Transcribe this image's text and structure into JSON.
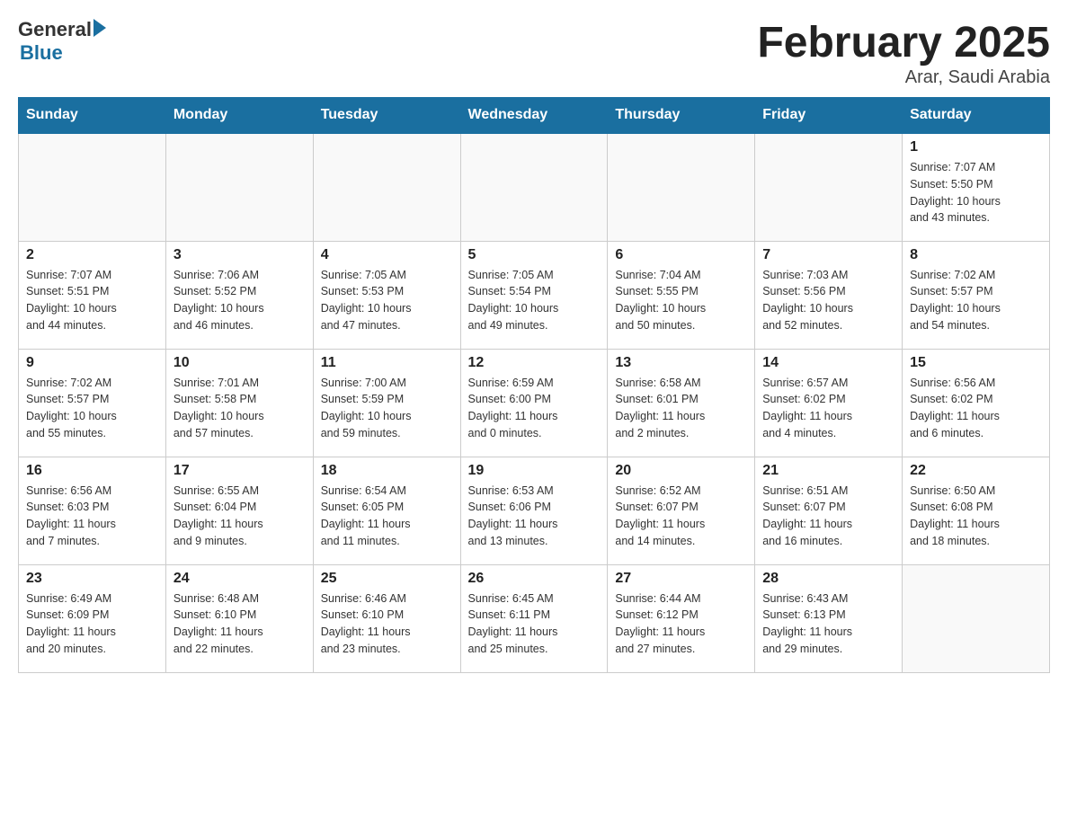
{
  "header": {
    "logo_general": "General",
    "logo_blue": "Blue",
    "month_title": "February 2025",
    "location": "Arar, Saudi Arabia"
  },
  "weekdays": [
    "Sunday",
    "Monday",
    "Tuesday",
    "Wednesday",
    "Thursday",
    "Friday",
    "Saturday"
  ],
  "weeks": [
    [
      {
        "day": "",
        "info": ""
      },
      {
        "day": "",
        "info": ""
      },
      {
        "day": "",
        "info": ""
      },
      {
        "day": "",
        "info": ""
      },
      {
        "day": "",
        "info": ""
      },
      {
        "day": "",
        "info": ""
      },
      {
        "day": "1",
        "info": "Sunrise: 7:07 AM\nSunset: 5:50 PM\nDaylight: 10 hours\nand 43 minutes."
      }
    ],
    [
      {
        "day": "2",
        "info": "Sunrise: 7:07 AM\nSunset: 5:51 PM\nDaylight: 10 hours\nand 44 minutes."
      },
      {
        "day": "3",
        "info": "Sunrise: 7:06 AM\nSunset: 5:52 PM\nDaylight: 10 hours\nand 46 minutes."
      },
      {
        "day": "4",
        "info": "Sunrise: 7:05 AM\nSunset: 5:53 PM\nDaylight: 10 hours\nand 47 minutes."
      },
      {
        "day": "5",
        "info": "Sunrise: 7:05 AM\nSunset: 5:54 PM\nDaylight: 10 hours\nand 49 minutes."
      },
      {
        "day": "6",
        "info": "Sunrise: 7:04 AM\nSunset: 5:55 PM\nDaylight: 10 hours\nand 50 minutes."
      },
      {
        "day": "7",
        "info": "Sunrise: 7:03 AM\nSunset: 5:56 PM\nDaylight: 10 hours\nand 52 minutes."
      },
      {
        "day": "8",
        "info": "Sunrise: 7:02 AM\nSunset: 5:57 PM\nDaylight: 10 hours\nand 54 minutes."
      }
    ],
    [
      {
        "day": "9",
        "info": "Sunrise: 7:02 AM\nSunset: 5:57 PM\nDaylight: 10 hours\nand 55 minutes."
      },
      {
        "day": "10",
        "info": "Sunrise: 7:01 AM\nSunset: 5:58 PM\nDaylight: 10 hours\nand 57 minutes."
      },
      {
        "day": "11",
        "info": "Sunrise: 7:00 AM\nSunset: 5:59 PM\nDaylight: 10 hours\nand 59 minutes."
      },
      {
        "day": "12",
        "info": "Sunrise: 6:59 AM\nSunset: 6:00 PM\nDaylight: 11 hours\nand 0 minutes."
      },
      {
        "day": "13",
        "info": "Sunrise: 6:58 AM\nSunset: 6:01 PM\nDaylight: 11 hours\nand 2 minutes."
      },
      {
        "day": "14",
        "info": "Sunrise: 6:57 AM\nSunset: 6:02 PM\nDaylight: 11 hours\nand 4 minutes."
      },
      {
        "day": "15",
        "info": "Sunrise: 6:56 AM\nSunset: 6:02 PM\nDaylight: 11 hours\nand 6 minutes."
      }
    ],
    [
      {
        "day": "16",
        "info": "Sunrise: 6:56 AM\nSunset: 6:03 PM\nDaylight: 11 hours\nand 7 minutes."
      },
      {
        "day": "17",
        "info": "Sunrise: 6:55 AM\nSunset: 6:04 PM\nDaylight: 11 hours\nand 9 minutes."
      },
      {
        "day": "18",
        "info": "Sunrise: 6:54 AM\nSunset: 6:05 PM\nDaylight: 11 hours\nand 11 minutes."
      },
      {
        "day": "19",
        "info": "Sunrise: 6:53 AM\nSunset: 6:06 PM\nDaylight: 11 hours\nand 13 minutes."
      },
      {
        "day": "20",
        "info": "Sunrise: 6:52 AM\nSunset: 6:07 PM\nDaylight: 11 hours\nand 14 minutes."
      },
      {
        "day": "21",
        "info": "Sunrise: 6:51 AM\nSunset: 6:07 PM\nDaylight: 11 hours\nand 16 minutes."
      },
      {
        "day": "22",
        "info": "Sunrise: 6:50 AM\nSunset: 6:08 PM\nDaylight: 11 hours\nand 18 minutes."
      }
    ],
    [
      {
        "day": "23",
        "info": "Sunrise: 6:49 AM\nSunset: 6:09 PM\nDaylight: 11 hours\nand 20 minutes."
      },
      {
        "day": "24",
        "info": "Sunrise: 6:48 AM\nSunset: 6:10 PM\nDaylight: 11 hours\nand 22 minutes."
      },
      {
        "day": "25",
        "info": "Sunrise: 6:46 AM\nSunset: 6:10 PM\nDaylight: 11 hours\nand 23 minutes."
      },
      {
        "day": "26",
        "info": "Sunrise: 6:45 AM\nSunset: 6:11 PM\nDaylight: 11 hours\nand 25 minutes."
      },
      {
        "day": "27",
        "info": "Sunrise: 6:44 AM\nSunset: 6:12 PM\nDaylight: 11 hours\nand 27 minutes."
      },
      {
        "day": "28",
        "info": "Sunrise: 6:43 AM\nSunset: 6:13 PM\nDaylight: 11 hours\nand 29 minutes."
      },
      {
        "day": "",
        "info": ""
      }
    ]
  ]
}
